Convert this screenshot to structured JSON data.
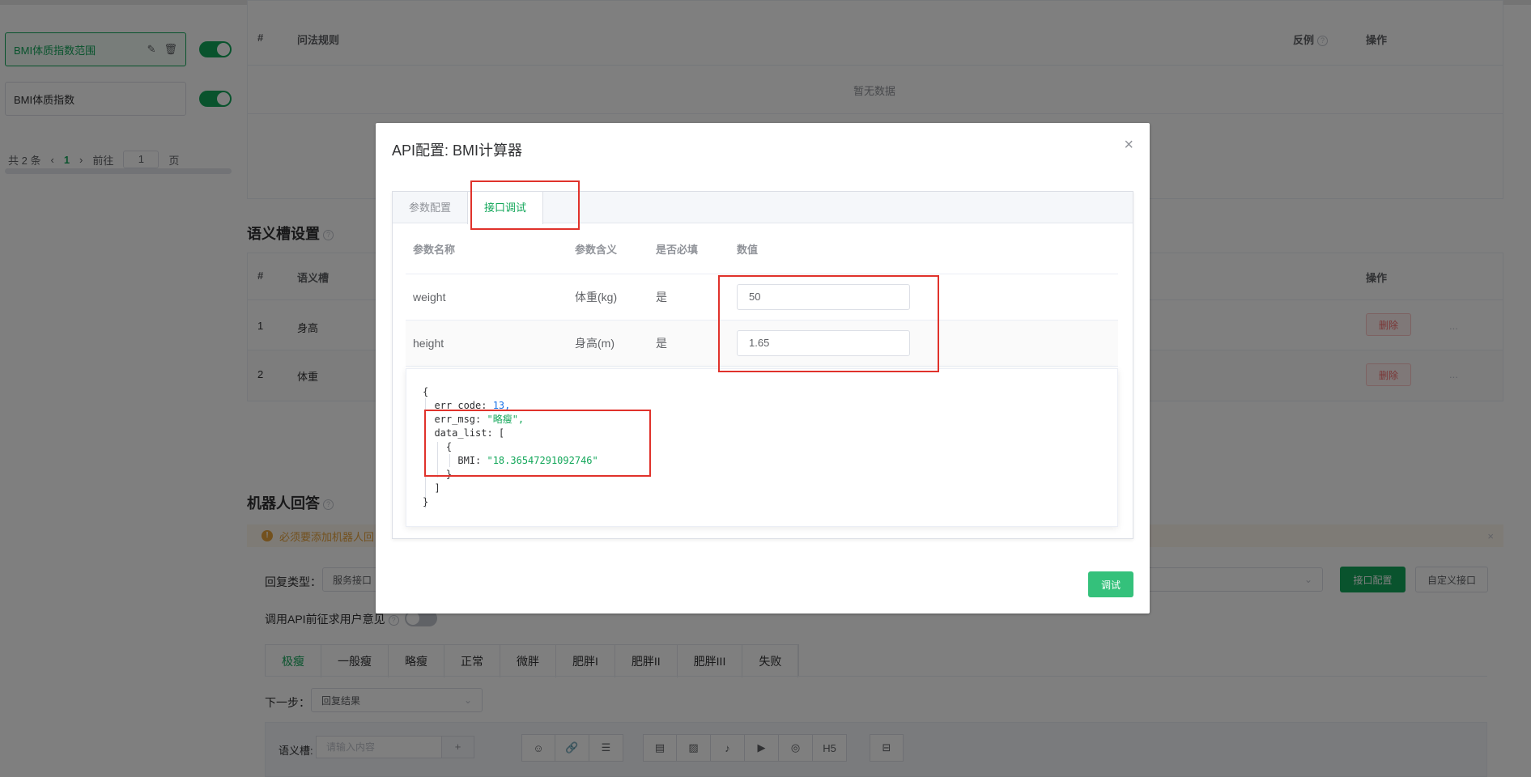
{
  "intents": [
    {
      "label": "BMI体质指数范围",
      "active": true,
      "enabled": true
    },
    {
      "label": "BMI体质指数",
      "active": false,
      "enabled": true
    }
  ],
  "pager": {
    "total": "共 2 条",
    "current": "1",
    "goto_label": "前往",
    "goto_value": "1",
    "page_suffix": "页"
  },
  "rules_table": {
    "col_num": "#",
    "col_rule": "问法规则",
    "col_counter": "反例",
    "col_op": "操作",
    "empty": "暂无数据"
  },
  "slots": {
    "title": "语义槽设置",
    "col_num": "#",
    "col_slot": "语义槽",
    "col_op": "操作",
    "rows": [
      {
        "num": "1",
        "name": "身高",
        "delete": "删除",
        "more": "..."
      },
      {
        "num": "2",
        "name": "体重",
        "delete": "删除",
        "more": "..."
      }
    ]
  },
  "robot": {
    "title": "机器人回答",
    "warning": "必须要添加机器人回",
    "reply_type_label": "回复类型：",
    "reply_type_value": "服务接口",
    "api_config_button": "接口配置",
    "custom_api_button": "自定义接口",
    "consent_label": "调用API前征求用户意见",
    "tabs": [
      "极瘦",
      "一般瘦",
      "略瘦",
      "正常",
      "微胖",
      "肥胖I",
      "肥胖II",
      "肥胖III",
      "失败"
    ],
    "next_step_label": "下一步：",
    "next_step_value": "回复结果",
    "slot_label": "语义槽:",
    "slot_placeholder": "请输入内容",
    "slot_add": "+",
    "h5_label": "H5"
  },
  "dialog": {
    "title": "API配置: BMI计算器",
    "close": "×",
    "tabs": [
      "参数配置",
      "接口调试"
    ],
    "active_tab": 1,
    "table": {
      "headers": [
        "参数名称",
        "参数含义",
        "是否必填",
        "数值"
      ],
      "rows": [
        {
          "name": "weight",
          "meaning": "体重(kg)",
          "required": "是",
          "value": "50"
        },
        {
          "name": "height",
          "meaning": "身高(m)",
          "required": "是",
          "value": "1.65"
        }
      ]
    },
    "result": {
      "open_brace": "{",
      "err_code_key": "err_code: ",
      "err_code_value": "13,",
      "err_msg_key": "err_msg: ",
      "err_msg_value": "\"略瘦\",",
      "data_list_key": "data_list: [",
      "item_open": "{",
      "bmi_key": "BMI: ",
      "bmi_value": "\"18.36547291092746\"",
      "item_close": "}",
      "list_close": "]",
      "close_brace": "}"
    },
    "debug_button": "调试"
  }
}
